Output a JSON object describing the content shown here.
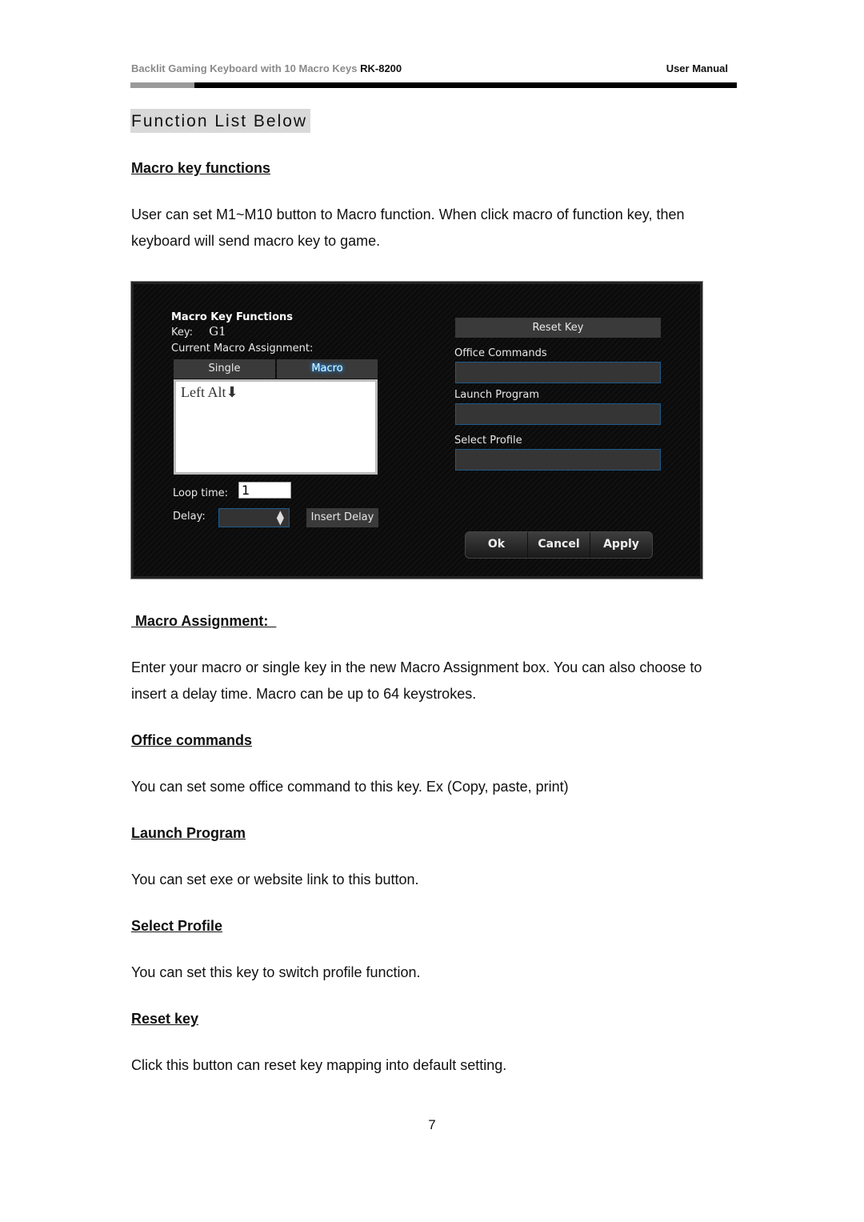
{
  "header": {
    "product": "Backlit Gaming Keyboard with 10 Macro Keys",
    "model": "RK-8200",
    "doc_type": "User Manual"
  },
  "section_title": "Function List Below",
  "sections": [
    {
      "heading": "Macro key functions",
      "body": "User can set M1~M10 button to Macro function. When click macro of function key, then keyboard will send macro key to game."
    },
    {
      "heading": " Macro Assignment:  ",
      "body": "Enter your macro or single key in the new Macro Assignment box. You can also choose to insert a delay time. Macro can be up to 64 keystrokes."
    },
    {
      "heading": "Office commands",
      "body": "You can set some office command to this key. Ex (Copy, paste, print)"
    },
    {
      "heading": "Launch Program",
      "body": "You can set exe or website link to this button."
    },
    {
      "heading": "Select Profile",
      "body": "You can set this key to switch profile function."
    },
    {
      "heading": "Reset key",
      "body": "Click this button can reset key mapping into default setting."
    }
  ],
  "screenshot": {
    "title": "Macro Key Functions",
    "key_label": "Key:",
    "key_value": "G1",
    "current_assignment_label": "Current Macro Assignment:",
    "tabs": [
      {
        "label": "Single",
        "active": false
      },
      {
        "label": "Macro",
        "active": true
      }
    ],
    "assignment_text": "Left Alt⬇",
    "loop_time_label": "Loop time:",
    "loop_time_value": "1",
    "delay_label": "Delay:",
    "delay_value": "",
    "insert_delay_label": "Insert Delay",
    "reset_key_label": "Reset Key",
    "office_commands_label": "Office Commands",
    "office_commands_value": "",
    "launch_program_label": "Launch Program",
    "launch_program_value": "",
    "select_profile_label": "Select Profile",
    "select_profile_value": "",
    "ok_label": "Ok",
    "cancel_label": "Cancel",
    "apply_label": "Apply",
    "accent_color": "#1e90ff"
  },
  "page_number": "7"
}
